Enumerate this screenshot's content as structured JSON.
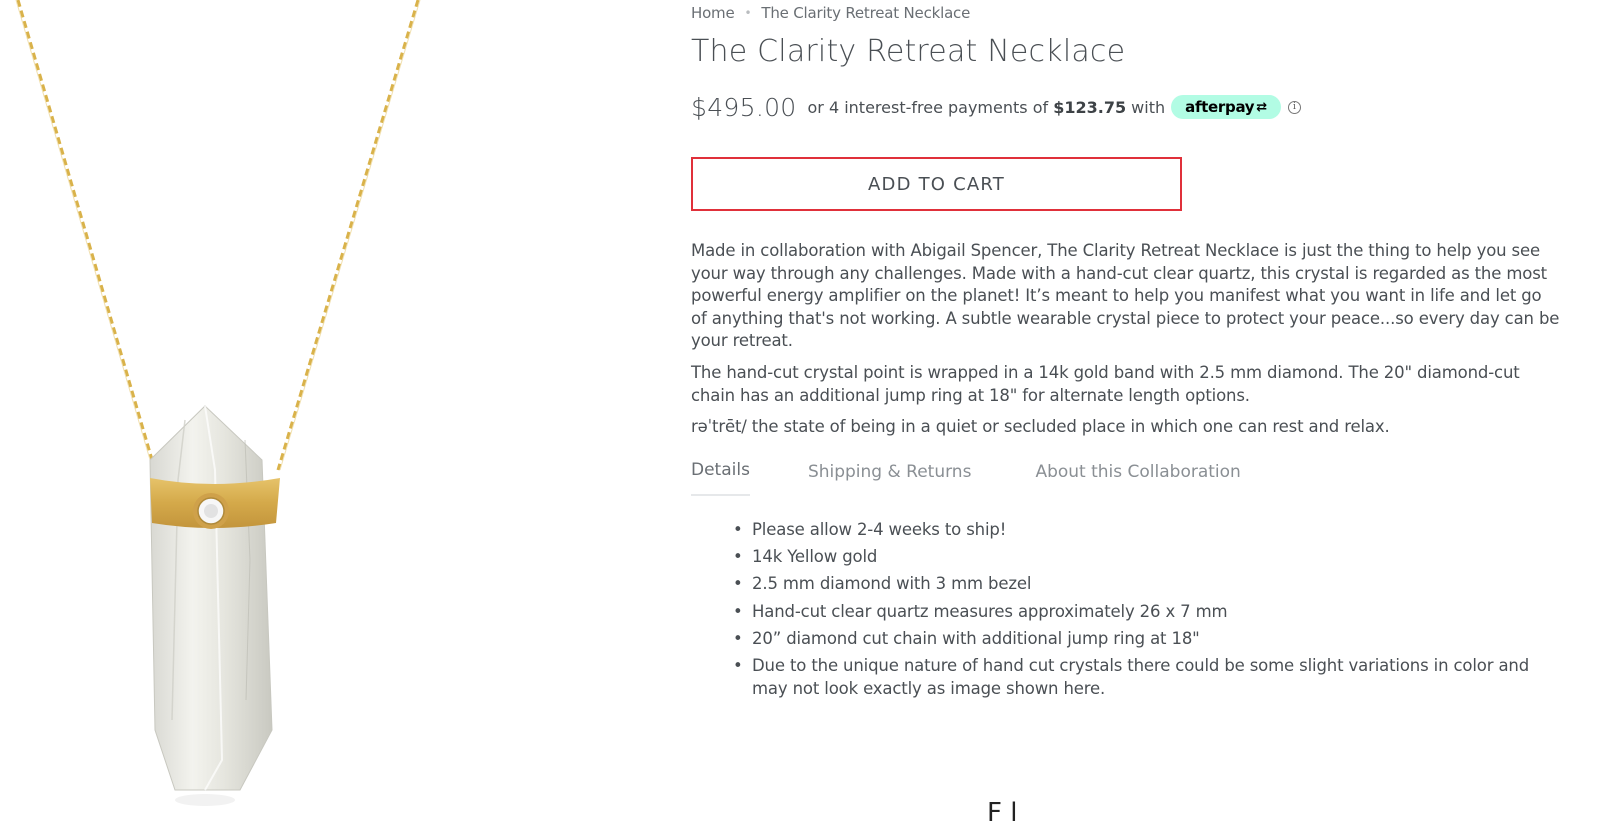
{
  "product": {
    "image_alt": "The Clarity Retreat Necklace"
  },
  "breadcrumb": {
    "home": "Home",
    "separator": "•",
    "current": "The Clarity Retreat Necklace"
  },
  "title": "The Clarity Retreat Necklace",
  "price": "$495.00",
  "installments": {
    "prefix": "or 4 interest-free payments of",
    "amount": "$123.75",
    "suffix": "with",
    "provider": "afterpay",
    "provider_color": "#b2fce4",
    "info_icon": "info-circle-icon"
  },
  "add_to_cart": "ADD TO CART",
  "add_to_cart_border_color": "#e0303a",
  "description": [
    "Made in collaboration with Abigail Spencer, The Clarity Retreat Necklace is just the thing to help you see your way through any challenges. Made with a hand-cut clear quartz, this crystal is regarded as the most powerful energy amplifier on the planet! It’s meant to help you manifest what you want in life and let go of anything that's not working. A subtle wearable crystal piece to protect your peace...so every day can be your retreat.",
    "The hand-cut crystal point is wrapped in a 14k gold band with 2.5 mm diamond. The 20\" diamond-cut chain has an additional jump ring at 18\" for alternate length options.",
    "rəˈtrēt/ the state of being in a quiet or secluded place in which one can rest and relax."
  ],
  "tabs": [
    {
      "label": "Details",
      "active": true
    },
    {
      "label": "Shipping & Returns",
      "active": false
    },
    {
      "label": "About this Collaboration",
      "active": false
    }
  ],
  "details": [
    "Please allow 2-4 weeks to ship!",
    "14k Yellow gold",
    "2.5 mm diamond with 3 mm bezel",
    "Hand-cut clear quartz measures approximately 26 x 7 mm",
    "20” diamond cut chain with additional jump ring at 18\"",
    "Due to the unique nature of hand cut crystals there could be some slight variations in color and may not look exactly as image shown here."
  ],
  "bottom_heading": "F            l"
}
